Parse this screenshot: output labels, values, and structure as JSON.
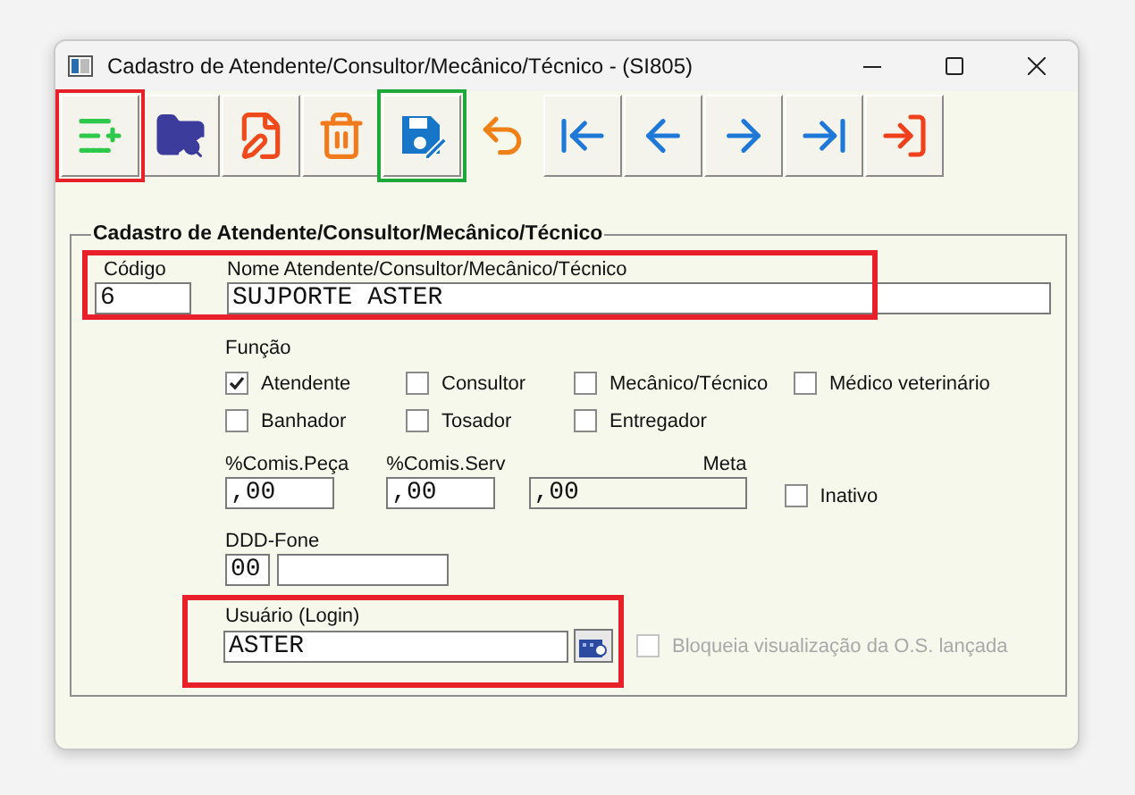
{
  "window": {
    "title": "Cadastro de Atendente/Consultor/Mecânico/Técnico - (SI805)"
  },
  "toolbar": [
    {
      "kind": "new",
      "raised": true,
      "color": "#e8202a"
    },
    {
      "kind": "search",
      "raised": true
    },
    {
      "kind": "edit",
      "raised": true
    },
    {
      "kind": "delete",
      "raised": true
    },
    {
      "kind": "save",
      "raised": true,
      "color": "#1fa83a"
    },
    {
      "kind": "undo",
      "raised": false
    },
    {
      "kind": "first",
      "raised": true
    },
    {
      "kind": "previous",
      "raised": true
    },
    {
      "kind": "next",
      "raised": true
    },
    {
      "kind": "last",
      "raised": true
    },
    {
      "kind": "exit",
      "raised": true
    }
  ],
  "group": {
    "title": "Cadastro de Atendente/Consultor/Mecânico/Técnico",
    "identity": {
      "color": "#e8202a",
      "code_label": "Código",
      "code": "6",
      "name_label": "Nome Atendente/Consultor/Mecânico/Técnico",
      "name": "SUJPORTE ASTER"
    },
    "function_label": "Função",
    "functions": [
      {
        "label": "Atendente",
        "checked": true
      },
      {
        "label": "Consultor",
        "checked": false
      },
      {
        "label": "Mecânico/Técnico",
        "checked": false
      },
      {
        "label": "Médico veterinário",
        "checked": false
      },
      {
        "label": "Banhador",
        "checked": false
      },
      {
        "label": "Tosador",
        "checked": false
      },
      {
        "label": "Entregador",
        "checked": false
      }
    ],
    "commission_part_label": "%Comis.Peça",
    "commission_part": ",00",
    "commission_service_label": "%Comis.Serv",
    "commission_service": ",00",
    "goal_label": "Meta",
    "goal": ",00",
    "inactive": {
      "label": "Inativo",
      "checked": false
    },
    "phone_label": "DDD-Fone",
    "area_code": "00",
    "login": {
      "color": "#e8202a",
      "label": "Usuário (Login)",
      "value": "ASTER"
    },
    "block_view": {
      "label": "Bloqueia visualização da O.S. lançada",
      "checked": false,
      "disabled": true
    }
  }
}
